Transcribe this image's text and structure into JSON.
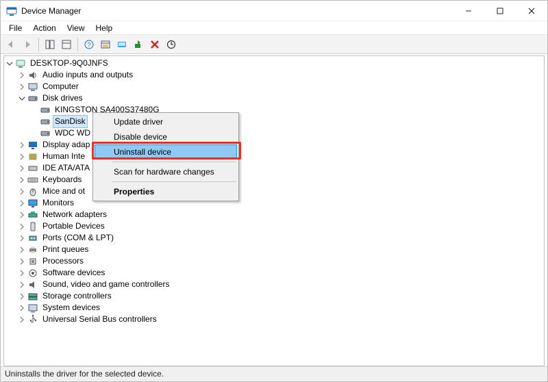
{
  "window": {
    "title": "Device Manager"
  },
  "menubar": {
    "file": "File",
    "action": "Action",
    "view": "View",
    "help": "Help"
  },
  "tree": {
    "root": "DESKTOP-9Q0JNFS",
    "audio": "Audio inputs and outputs",
    "computer": "Computer",
    "disk_drives": "Disk drives",
    "disk_kingston": "KINGSTON SA400S37480G",
    "disk_sandisk": "SanDisk",
    "disk_wdc": "WDC WD",
    "display": "Display adap",
    "hid": "Human Inte",
    "ide": "IDE ATA/ATA",
    "keyboards": "Keyboards",
    "mice": "Mice and ot",
    "monitors": "Monitors",
    "network": "Network adapters",
    "portable": "Portable Devices",
    "ports": "Ports (COM & LPT)",
    "print": "Print queues",
    "processors": "Processors",
    "software": "Software devices",
    "sound": "Sound, video and game controllers",
    "storage": "Storage controllers",
    "system": "System devices",
    "usb": "Universal Serial Bus controllers"
  },
  "context_menu": {
    "update": "Update driver",
    "disable": "Disable device",
    "uninstall": "Uninstall device",
    "scan": "Scan for hardware changes",
    "properties": "Properties"
  },
  "statusbar": {
    "text": "Uninstalls the driver for the selected device."
  }
}
